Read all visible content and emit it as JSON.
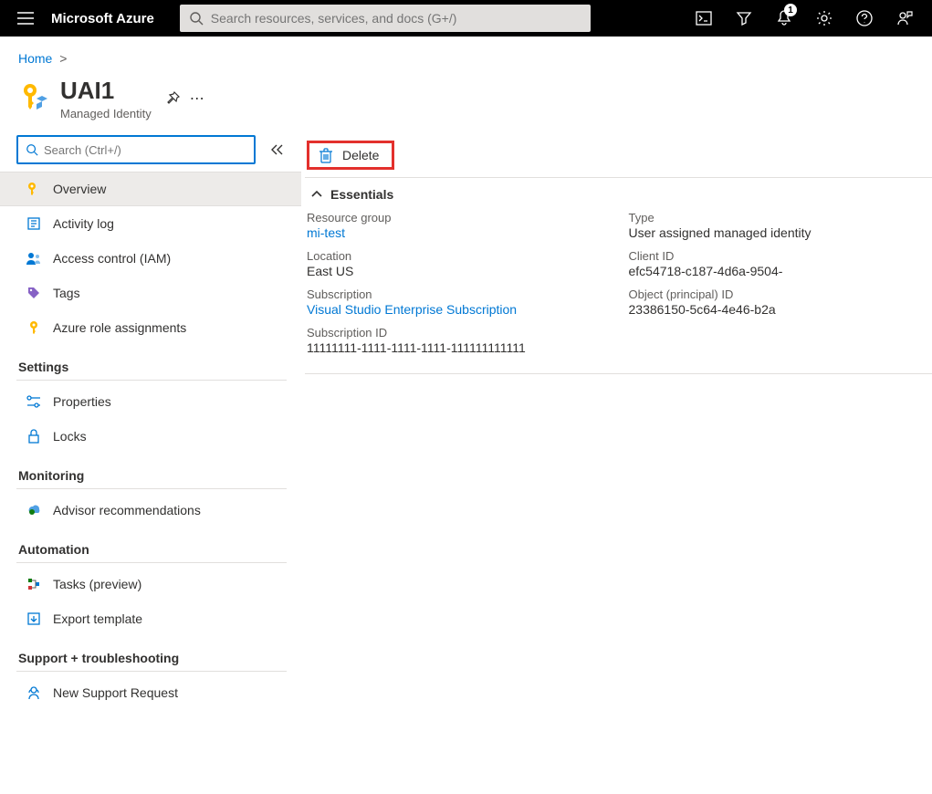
{
  "header": {
    "brand": "Microsoft Azure",
    "search_placeholder": "Search resources, services, and docs (G+/)",
    "notification_badge": "1"
  },
  "breadcrumb": {
    "items": [
      "Home"
    ],
    "sep": ">"
  },
  "resource": {
    "name": "UAI1",
    "type_label": "Managed Identity"
  },
  "sidebar": {
    "search_placeholder": "Search (Ctrl+/)",
    "items_top": [
      {
        "label": "Overview",
        "active": true
      },
      {
        "label": "Activity log"
      },
      {
        "label": "Access control (IAM)"
      },
      {
        "label": "Tags"
      },
      {
        "label": "Azure role assignments"
      }
    ],
    "sections": [
      {
        "title": "Settings",
        "items": [
          {
            "label": "Properties"
          },
          {
            "label": "Locks"
          }
        ]
      },
      {
        "title": "Monitoring",
        "items": [
          {
            "label": "Advisor recommendations"
          }
        ]
      },
      {
        "title": "Automation",
        "items": [
          {
            "label": "Tasks (preview)"
          },
          {
            "label": "Export template"
          }
        ]
      },
      {
        "title": "Support + troubleshooting",
        "items": [
          {
            "label": "New Support Request"
          }
        ]
      }
    ]
  },
  "commands": {
    "delete_label": "Delete"
  },
  "essentials": {
    "header": "Essentials",
    "left": [
      {
        "label": "Resource group",
        "value": "mi-test",
        "link": true
      },
      {
        "label": "Location",
        "value": "East US"
      },
      {
        "label": "Subscription",
        "value": "Visual Studio Enterprise Subscription",
        "link": true
      },
      {
        "label": "Subscription ID",
        "value": "11111111-1111-1111-1111-111111111111"
      }
    ],
    "right": [
      {
        "label": "Type",
        "value": "User assigned managed identity"
      },
      {
        "label": "Client ID",
        "value": "efc54718-c187-4d6a-9504-"
      },
      {
        "label": "Object (principal) ID",
        "value": "23386150-5c64-4e46-b2a"
      }
    ]
  }
}
